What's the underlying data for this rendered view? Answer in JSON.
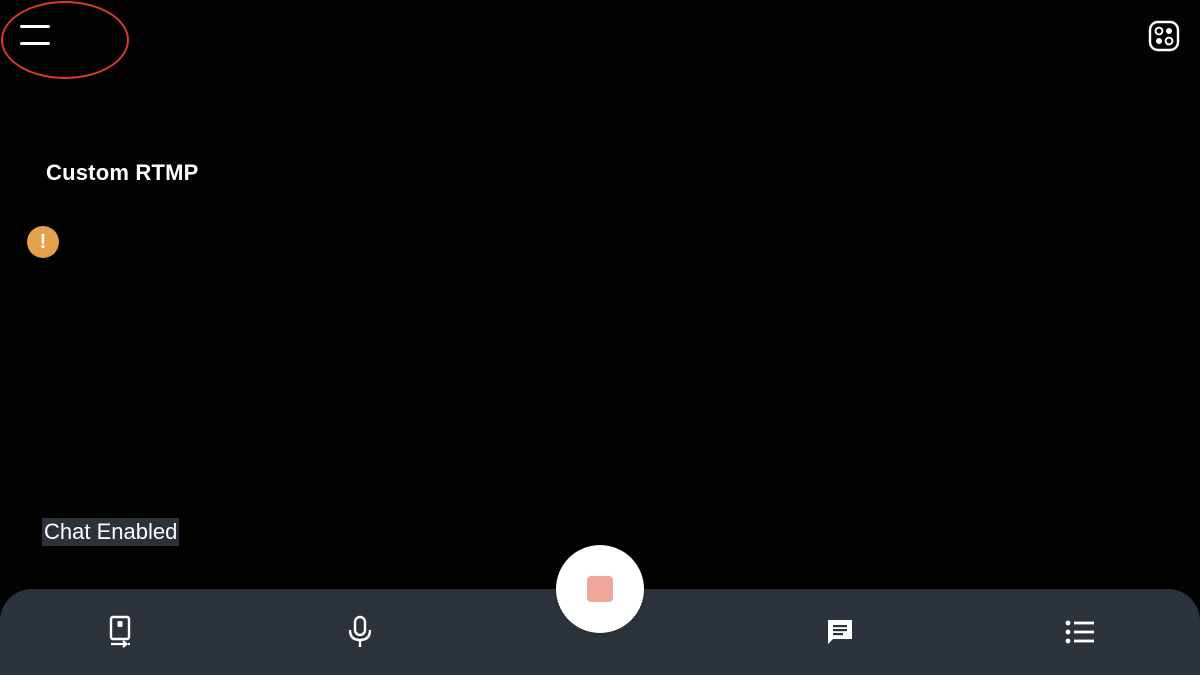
{
  "stream": {
    "title": "Custom RTMP"
  },
  "chat": {
    "status_label": "Chat Enabled"
  },
  "warning": {
    "glyph": "!",
    "icon": "warning-icon"
  },
  "top_bar": {
    "menu_icon": "hamburger-menu-icon",
    "camera_icon": "camera-switch-icon"
  },
  "bottom_bar": {
    "items": [
      {
        "icon": "scene-switch-icon"
      },
      {
        "icon": "microphone-icon"
      },
      {
        "icon": "record-stop-icon"
      },
      {
        "icon": "chat-icon"
      },
      {
        "icon": "list-menu-icon"
      }
    ]
  },
  "colors": {
    "background": "#020202",
    "bottom_bar": "#2d333c",
    "warning": "#e2a14a",
    "record_stop": "#f0a79b",
    "highlight": "#d63a2c",
    "chat_badge": "#2c323b"
  }
}
